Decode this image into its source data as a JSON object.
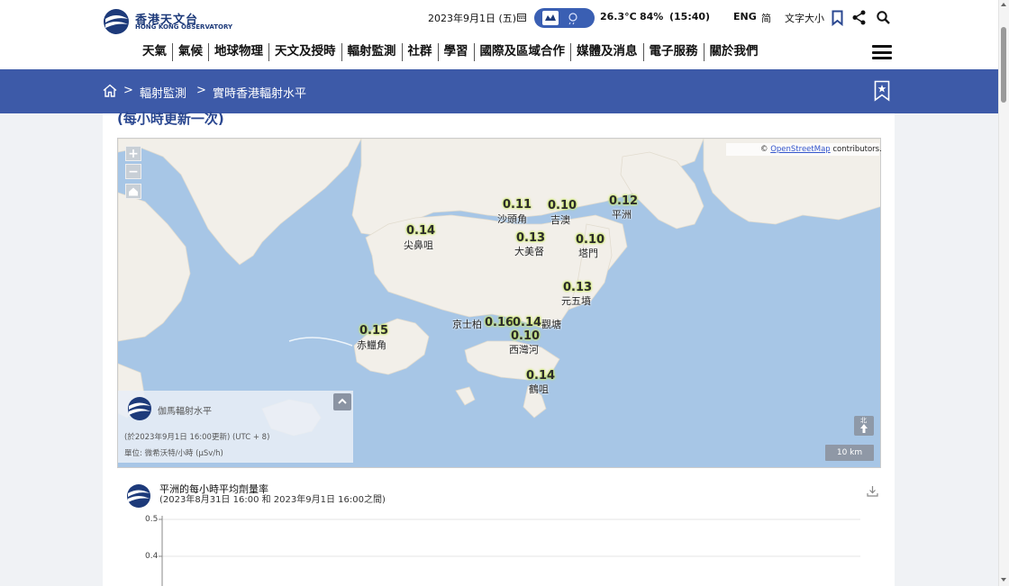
{
  "header": {
    "logo_cn": "香港天文台",
    "logo_en": "HONG KONG OBSERVATORY",
    "date": "2023年9月1日 (五)",
    "temperature": "26.3°C",
    "humidity": "84%",
    "time": "(15:40)",
    "lang_eng": "ENG",
    "lang_sc": "简",
    "font_size": "文字大小"
  },
  "nav": [
    "天氣",
    "氣候",
    "地球物理",
    "天文及授時",
    "輻射監測",
    "社群",
    "學習",
    "國際及區域合作",
    "媒體及消息",
    "電子服務",
    "關於我們"
  ],
  "breadcrumb": {
    "sep": ">",
    "level1": "輻射監測",
    "level2": "實時香港輻射水平"
  },
  "update_note": "(每小時更新一次)",
  "map": {
    "zoom_in": "+",
    "zoom_out": "−",
    "attribution_prefix": "©",
    "attribution_link": "OpenStreetMap",
    "attribution_suffix": "contributors.",
    "stations": [
      {
        "value": "0.11",
        "name": "沙頭角"
      },
      {
        "value": "0.10",
        "name": "吉澳"
      },
      {
        "value": "0.12",
        "name": "平洲"
      },
      {
        "value": "0.14",
        "name": "尖鼻咀"
      },
      {
        "value": "0.13",
        "name": "大美督"
      },
      {
        "value": "0.10",
        "name": "塔門"
      },
      {
        "value": "0.13",
        "name": "元五墳"
      },
      {
        "value": "0.16",
        "name": "京士柏"
      },
      {
        "value": "0.14",
        "name": "觀塘"
      },
      {
        "value": "0.15",
        "name": "赤鱲角"
      },
      {
        "value": "0.10",
        "name": "西灣河"
      },
      {
        "value": "0.14",
        "name": "鶴咀"
      }
    ],
    "legend_title": "伽馬輻射水平",
    "legend_time": "(於2023年9月1日 16:00更新) (UTC + 8)",
    "legend_unit": "單位: 微希沃特/小時 (μSv/h)",
    "north_label": "北",
    "scale": "10 km"
  },
  "chart": {
    "title": "平洲的每小時平均劑量率",
    "subtitle": "(2023年8月31日 16:00 和 2023年9月1日 16:00之間)",
    "yticks": [
      "0.5",
      "0.4"
    ]
  },
  "colors": {
    "brand_blue": "#3d5aa8",
    "station_highlight": "#cdea6a",
    "sea": "#a7c6e6",
    "land": "#f2efe9"
  },
  "icons": [
    "calendar-icon",
    "weather-icon",
    "bookmark-icon",
    "share-icon",
    "search-icon",
    "menu-icon",
    "home-icon",
    "bookmark-add-icon",
    "home-view-icon",
    "collapse-up-icon",
    "north-arrow-icon",
    "download-icon"
  ]
}
